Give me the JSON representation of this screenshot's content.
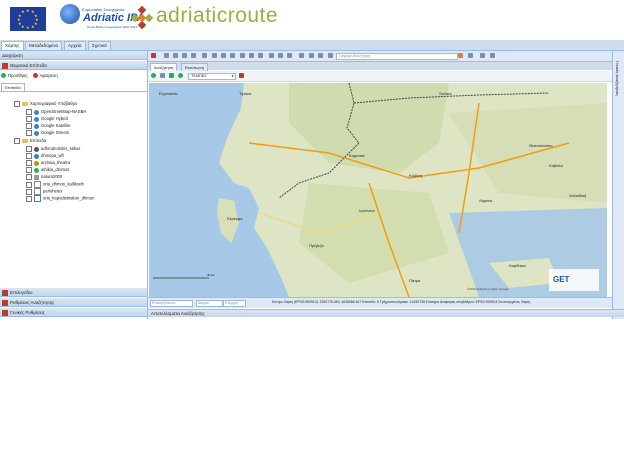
{
  "header": {
    "ipa_small": "Ευρωπαϊκή Συνεργασία",
    "ipa_big": "Adriatic IPA",
    "ipa_sub": "Cross-Border Cooperation 2007-2013",
    "app_name": "adriaticroute"
  },
  "top_tabs": [
    "Χάρτης",
    "Μεταδεδομένα",
    "Αρχεία",
    "Σχετικά"
  ],
  "left_panel": {
    "section_title": "Διαχείριση",
    "layers_title": "Θεματικά Επίπεδα",
    "add_label": "Προσθήκη",
    "remove_label": "Αφαίρεση",
    "tab_label": "Επίπεδα",
    "base_folder": "Χαρτογραφικό Υπόβαθρο",
    "base_layers": [
      "OpenStreetMap-NASBH",
      "Google Hybrid",
      "Google Satellite",
      "Google Streets"
    ],
    "layers_folder": "Επίπεδα",
    "layers": [
      "adhrodromikis_stikus",
      "dhmopa_wfl",
      "archaia_theatra",
      "athikia_dromos",
      "natura2000",
      "oria_dhmon_kallikrath",
      "perioheies",
      "oria_kapodistriakon_dhmon"
    ],
    "bottom_sections": [
      "Επιλογόδιο",
      "Ρυθμίσεις Αναζήτησης",
      "Γενικές Ρυθμίσεις"
    ]
  },
  "toolbar": {
    "search_placeholder": "Γρήγορη Αναζήτηση"
  },
  "sub_tabs": [
    "Αναζήτηση",
    "Εκτύπωση"
  ],
  "control_bar": {
    "select_value": "ΤΕΜΠΕΣ"
  },
  "map": {
    "labels": [
      "Ελμπασάν",
      "Τίρανα",
      "Σκόπια",
      "Ιωάννινα",
      "Κέρκυρα",
      "Πάτρα",
      "Λάρισα",
      "Θεσσαλονίκη",
      "Καρδίτσα",
      "Πρέβεζα",
      "Καβάλα",
      "Χαλκιδική",
      "Κοζάνη",
      "Κορυτσά"
    ],
    "scale_label": "40 km",
    "attribution": "©2015 Δεδομένα χάρτη Google"
  },
  "status_bar": {
    "field_1": "Επιλογή τύπου",
    "field_2": "Αίτημα",
    "field_3": "Έλεγχος",
    "coords_text": "Κέντρο Χάρτη (EPSG:900913): 2320776.450, 4635066.467 Επίπεδο: 8 Τρέχουσα κλίμακα: 1:1150735 Σύστημα Αναφοράς υποβάθρου: EPSG:900913 Συντεταγμένες Χάρτη"
  },
  "right_strip": {
    "label": "Γενικές Αναζητήσεις"
  },
  "bottom_bar": {
    "label": "Αποτελέσματα Αναζήτησης"
  },
  "get_logo": "GET"
}
